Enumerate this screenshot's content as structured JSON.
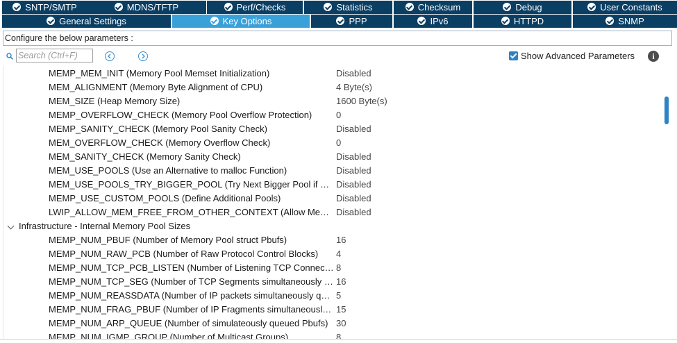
{
  "tabs_row1": [
    {
      "label": "SNTP/SMTP",
      "checked": true
    },
    {
      "label": "MDNS/TFTP",
      "checked": true
    },
    {
      "label": "Perf/Checks",
      "checked": true
    },
    {
      "label": "Statistics",
      "checked": true
    },
    {
      "label": "Checksum",
      "checked": true
    },
    {
      "label": "Debug",
      "checked": true
    },
    {
      "label": "User Constants",
      "checked": true
    }
  ],
  "tabs_row2": [
    {
      "label": "General Settings",
      "checked": true,
      "active": false
    },
    {
      "label": "Key Options",
      "checked": true,
      "active": true
    },
    {
      "label": "PPP",
      "checked": true,
      "active": false
    },
    {
      "label": "IPv6",
      "checked": true,
      "active": false
    },
    {
      "label": "HTTPD",
      "checked": true,
      "active": false
    },
    {
      "label": "SNMP",
      "checked": true,
      "active": false
    }
  ],
  "configure_label": "Configure the below parameters :",
  "search": {
    "placeholder": "Search (Ctrl+F)",
    "value": ""
  },
  "show_advanced": {
    "label": "Show Advanced Parameters",
    "checked": true
  },
  "icons": {
    "search": "search-icon",
    "prev": "arrow-left-circle-icon",
    "next": "arrow-right-circle-icon",
    "info": "info-icon",
    "expand": "chevron-down-icon"
  },
  "colors": {
    "tab_bg": "#0b3e63",
    "tab_active": "#3aa0d8",
    "accent": "#2d83c4"
  },
  "parameters": [
    {
      "name": "MEMP_MEM_INIT (Memory Pool Memset Initialization)",
      "value": "Disabled",
      "group": false
    },
    {
      "name": "MEM_ALIGNMENT (Memory Byte Alignment of CPU)",
      "value": "4 Byte(s)",
      "group": false
    },
    {
      "name": "MEM_SIZE (Heap Memory Size)",
      "value": "1600 Byte(s)",
      "group": false
    },
    {
      "name": "MEMP_OVERFLOW_CHECK (Memory Pool Overflow Protection)",
      "value": "0",
      "group": false
    },
    {
      "name": "MEMP_SANITY_CHECK (Memory Pool Sanity Check)",
      "value": "Disabled",
      "group": false
    },
    {
      "name": "MEM_OVERFLOW_CHECK (Memory Overflow Check)",
      "value": "0",
      "group": false
    },
    {
      "name": "MEM_SANITY_CHECK (Memory Sanity Check)",
      "value": "Disabled",
      "group": false
    },
    {
      "name": "MEM_USE_POOLS (Use an Alternative to malloc Function)",
      "value": "Disabled",
      "group": false
    },
    {
      "name": "MEM_USE_POOLS_TRY_BIGGER_POOL (Try Next Bigger Pool if Current Pool Empty)",
      "value": "Disabled",
      "group": false
    },
    {
      "name": "MEMP_USE_CUSTOM_POOLS (Define Additional Pools)",
      "value": "Disabled",
      "group": false
    },
    {
      "name": "LWIP_ALLOW_MEM_FREE_FROM_OTHER_CONTEXT (Allow Memory Free From Other Context)",
      "value": "Disabled",
      "group": false
    },
    {
      "name": "Infrastructure - Internal Memory Pool Sizes",
      "value": "",
      "group": true
    },
    {
      "name": "MEMP_NUM_PBUF (Number of Memory Pool struct Pbufs)",
      "value": "16",
      "group": false
    },
    {
      "name": "MEMP_NUM_RAW_PCB (Number of Raw Protocol Control Blocks)",
      "value": "4",
      "group": false
    },
    {
      "name": "MEMP_NUM_TCP_PCB_LISTEN (Number of Listening TCP Connections)",
      "value": "8",
      "group": false
    },
    {
      "name": "MEMP_NUM_TCP_SEG (Number of TCP Segments simultaneously Queued)",
      "value": "16",
      "group": false
    },
    {
      "name": "MEMP_NUM_REASSDATA (Number of IP packets simultaneously queued for reassembly)",
      "value": "5",
      "group": false
    },
    {
      "name": "MEMP_NUM_FRAG_PBUF (Number of IP Fragments simultaneously sent)",
      "value": "15",
      "group": false
    },
    {
      "name": "MEMP_NUM_ARP_QUEUE (Number of simulateously queued Pbufs)",
      "value": "30",
      "group": false
    },
    {
      "name": "MEMP_NUM_IGMP_GROUP (Number of Multicast Groups)",
      "value": "8",
      "group": false
    }
  ]
}
